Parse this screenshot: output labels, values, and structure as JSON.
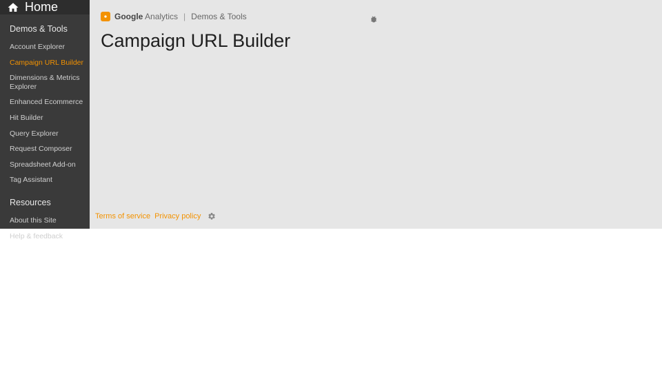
{
  "home_label": "Home",
  "brand": {
    "word1_bold": "Google",
    "word1_light": "Analytics",
    "suffix": "Demos & Tools"
  },
  "page_title": "Campaign URL Builder",
  "sidebar": {
    "sections": [
      {
        "title": "Demos & Tools",
        "items": [
          {
            "label": "Account Explorer",
            "active": false
          },
          {
            "label": "Campaign URL Builder",
            "active": true
          },
          {
            "label": "Dimensions & Metrics Explorer",
            "active": false
          },
          {
            "label": "Enhanced Ecommerce",
            "active": false
          },
          {
            "label": "Hit Builder",
            "active": false
          },
          {
            "label": "Query Explorer",
            "active": false
          },
          {
            "label": "Request Composer",
            "active": false
          },
          {
            "label": "Spreadsheet Add-on",
            "active": false
          },
          {
            "label": "Tag Assistant",
            "active": false
          }
        ]
      },
      {
        "title": "Resources",
        "items": [
          {
            "label": "About this Site",
            "active": false
          },
          {
            "label": "Help & feedback",
            "active": false
          }
        ]
      }
    ]
  },
  "footer": {
    "terms": "Terms of service",
    "privacy": "Privacy policy"
  }
}
